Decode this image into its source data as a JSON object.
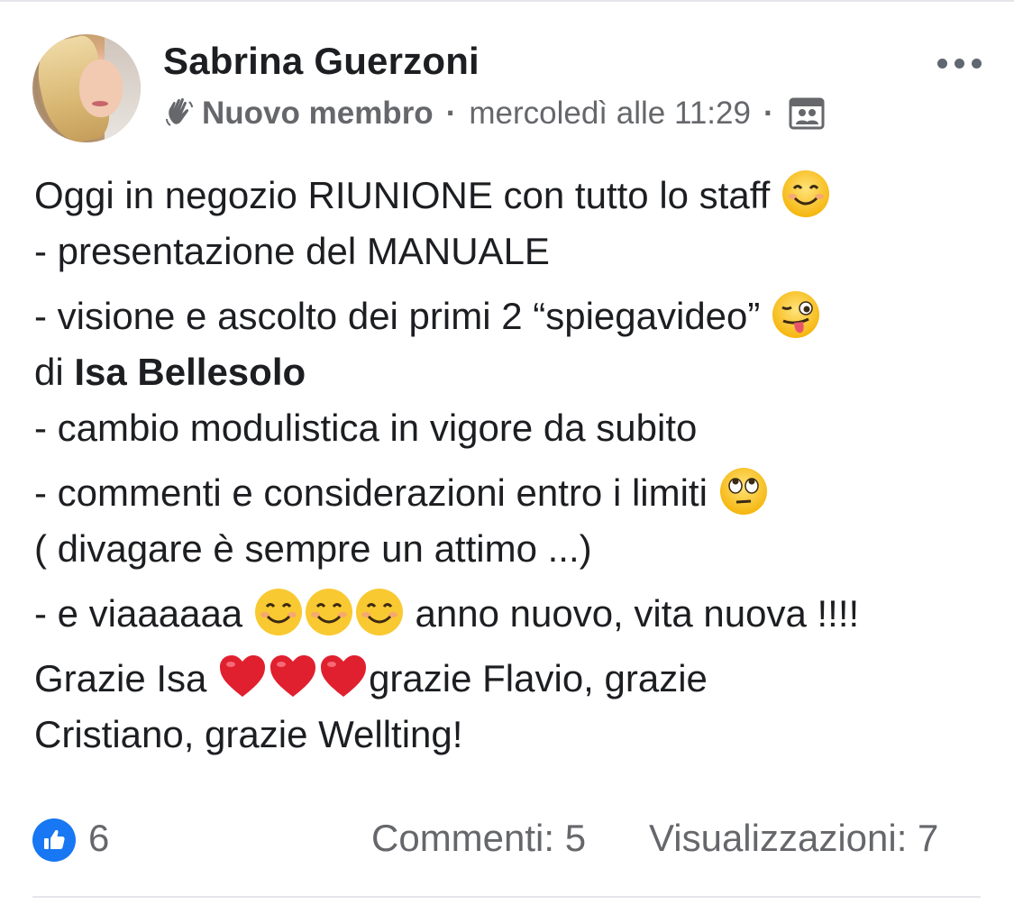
{
  "post": {
    "author": "Sabrina Guerzoni",
    "badge": "Nuovo membro",
    "timestamp": "mercoledì alle 11:29",
    "separator": "·",
    "lines": {
      "l1": "Oggi in negozio RIUNIONE con tutto lo staff ",
      "l2": "- presentazione del MANUALE",
      "l3": "- visione e ascolto dei primi 2 “spiegavideo” ",
      "l4_prefix": "di  ",
      "l4_mention": "Isa Bellesolo",
      "l5": "- cambio modulistica in vigore da subito",
      "l6": "- commenti e considerazioni entro i limiti ",
      "l7": "( divagare è sempre un attimo ...)",
      "l8_a": "- e viaaaaaa ",
      "l8_b": " anno nuovo, vita nuova !!!!",
      "l9_a": "Grazie Isa ",
      "l9_b": "grazie Flavio, grazie",
      "l10": "Cristiano, grazie Wellting!"
    }
  },
  "footer": {
    "likes": "6",
    "comments": "Commenti: 5",
    "views": "Visualizzazioni: 7"
  },
  "icons": {
    "more": "more-options-icon",
    "wave": "waving-hand-icon",
    "group": "group-audience-icon",
    "like": "like-icon",
    "smile": "smiling-face-emoji",
    "wink_tongue": "winking-face-tongue-emoji",
    "eye_roll": "eye-roll-emoji",
    "heart": "red-heart-emoji"
  },
  "colors": {
    "accent": "#1877f2",
    "muted": "#65676b",
    "text": "#1c1e21"
  }
}
